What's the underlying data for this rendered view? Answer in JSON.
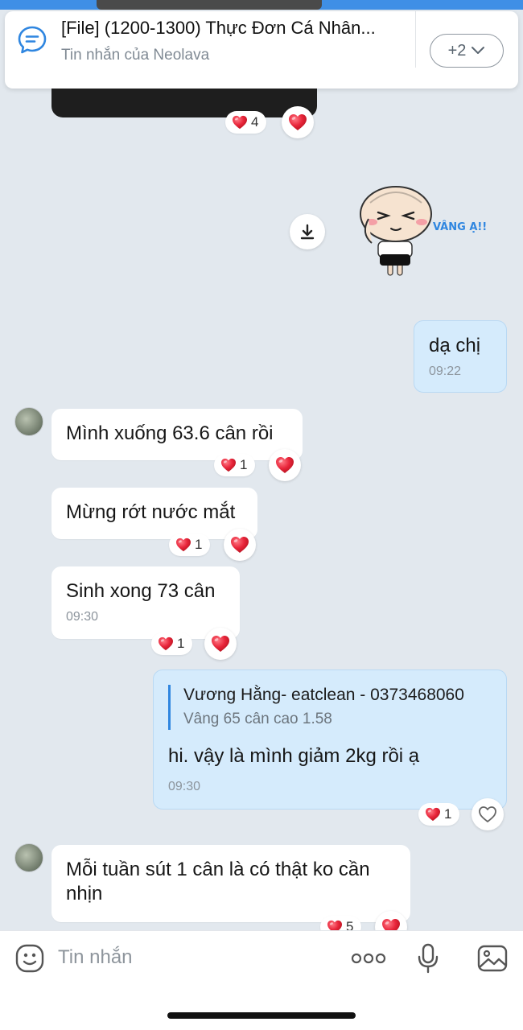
{
  "pinned": {
    "title": "[File] (1200-1300) Thực Đơn Cá Nhân...",
    "subtitle": "Tin nhắn của Neolava",
    "more_label": "+2"
  },
  "sticker": {
    "caption": "VÂNG Ạ!!"
  },
  "messages": {
    "photo_reaction_count": "4",
    "out1": {
      "text": "dạ chị",
      "time": "09:22"
    },
    "in1": {
      "text": "Mình xuống 63.6 cân rồi",
      "reaction_count": "1"
    },
    "in2": {
      "text": "Mừng rớt nước mắt",
      "reaction_count": "1"
    },
    "in3": {
      "text": "Sinh xong 73 cân",
      "time": "09:30",
      "reaction_count": "1"
    },
    "out2": {
      "quote_name": "Vương Hằng- eatclean - 0373468060",
      "quote_text": "Vâng 65 cân cao 1.58",
      "text": "hi. vậy là mình giảm 2kg rồi ạ",
      "time": "09:30",
      "reaction_count": "1"
    },
    "in4": {
      "text": "Mỗi tuần sút 1 cân là có thật ko cần nhịn",
      "reaction_count": "5"
    }
  },
  "input": {
    "placeholder": "Tin nhắn"
  },
  "colors": {
    "heart": "#e8253a",
    "accent": "#2f86e0",
    "outgoing_bubble": "#d5ebfc"
  }
}
